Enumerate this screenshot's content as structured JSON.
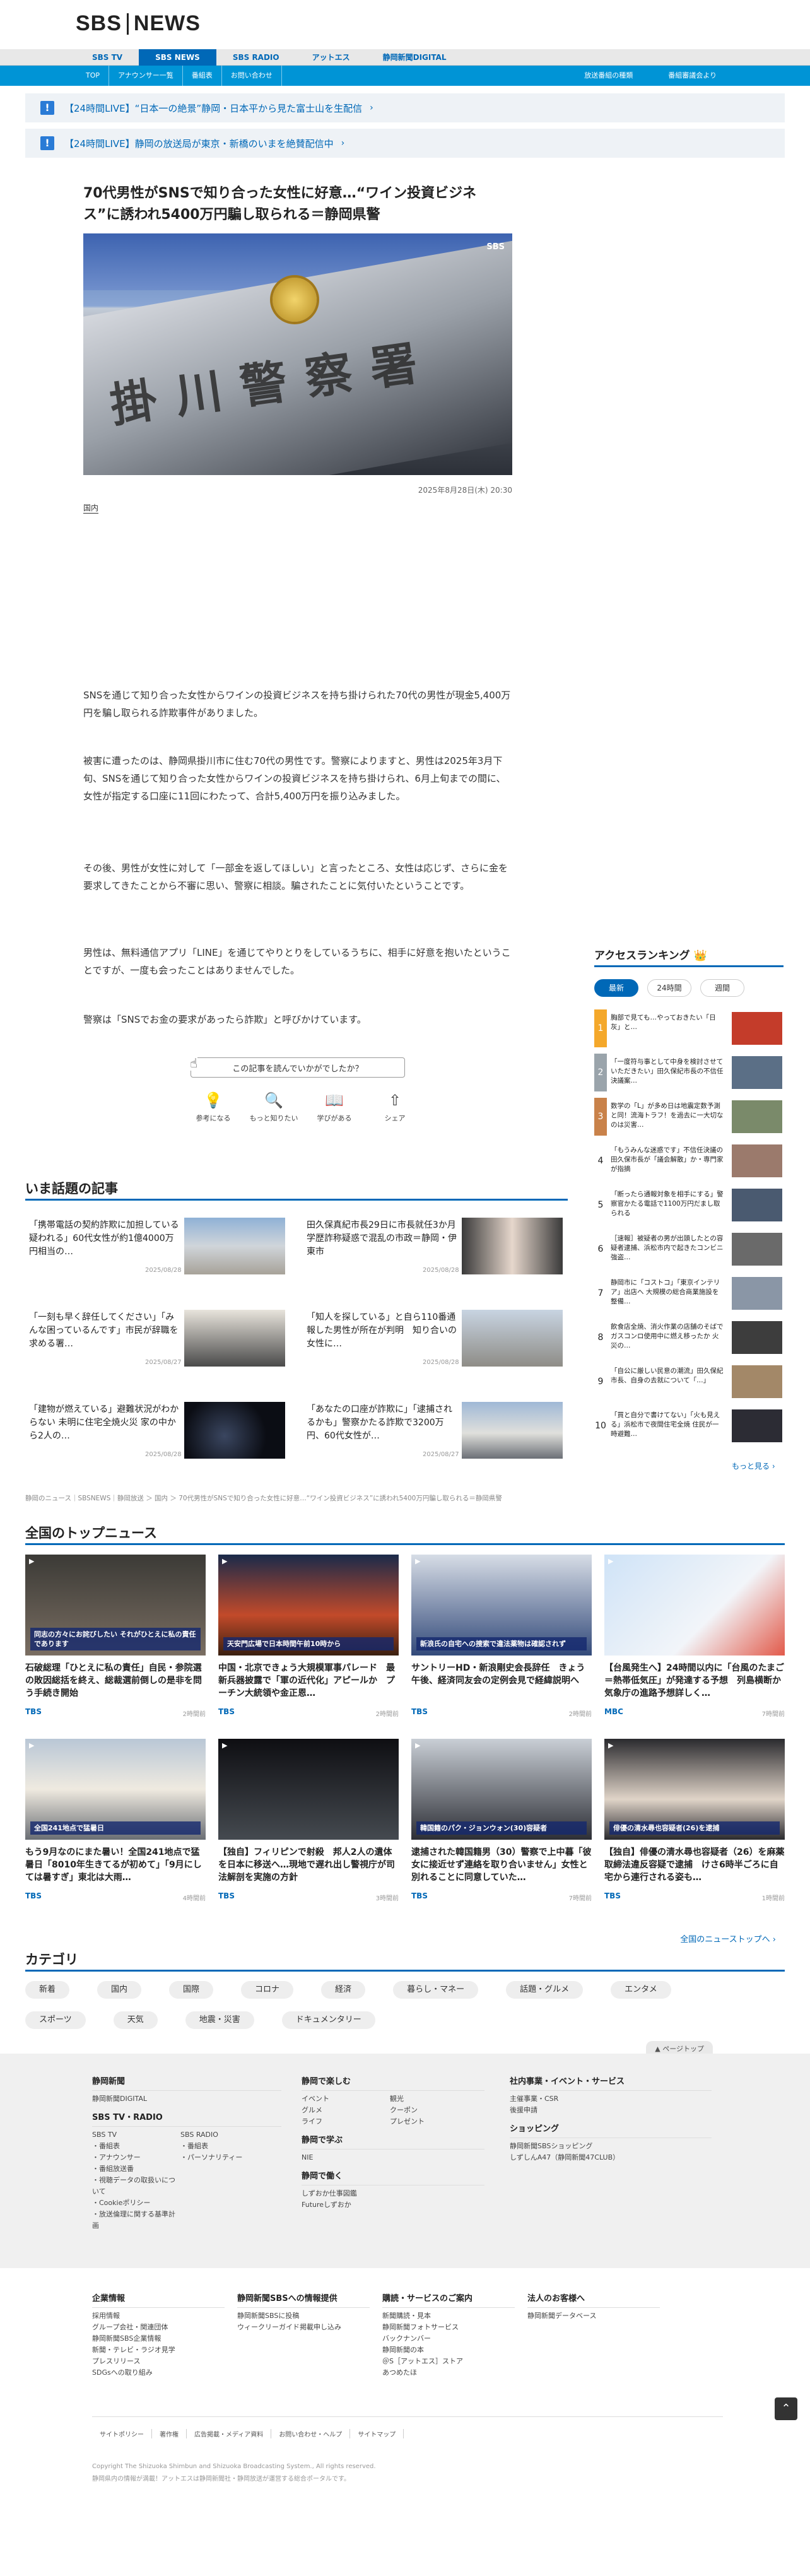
{
  "header": {
    "logo_a": "SBS",
    "logo_b": "NEWS"
  },
  "nav1": [
    {
      "label": "SBS TV"
    },
    {
      "label": "SBS NEWS"
    },
    {
      "label": "SBS RADIO"
    },
    {
      "label": "アットエス"
    },
    {
      "label": "静岡新聞DIGITAL"
    }
  ],
  "nav2": {
    "left": [
      "TOP",
      "アナウンサー一覧",
      "番組表",
      "お問い合わせ"
    ],
    "right": [
      "放送番組の種類",
      "番組審議会より"
    ]
  },
  "alerts": [
    "【24時間LIVE】“日本一の絶景”静岡・日本平から見た富士山を生配信",
    "【24時間LIVE】静岡の放送局が東京・新橋のいまを絶賛配信中"
  ],
  "article": {
    "title": "70代男性がSNSで知り合った女性に好意…“ワイン投資ビジネス”に誘われ5400万円騙し取られる＝静岡県警",
    "image_watermark": "SBS",
    "image_kanji": "掛川警察署",
    "date": "2025年8月28日(木) 20:30",
    "category": "国内",
    "paras": [
      "SNSを通じて知り合った女性からワインの投資ビジネスを持ち掛けられた70代の男性が現金5,400万円を騙し取られる詐欺事件がありました。",
      "被害に遭ったのは、静岡県掛川市に住む70代の男性です。警察によりますと、男性は2025年3月下旬、SNSを通じて知り合った女性からワインの投資ビジネスを持ち掛けられ、6月上旬までの間に、女性が指定する口座に11回にわたって、合計5,400万円を振り込みました。",
      "その後、男性が女性に対して「一部金を返してほしい」と言ったところ、女性は応じず、さらに金を要求してきたことから不審に思い、警察に相談。騙されたことに気付いたということです。",
      "男性は、無料通信アプリ「LINE」を通じてやりとりをしているうちに、相手に好意を抱いたということですが、一度も会ったことはありませんでした。",
      "警察は「SNSでお金の要求があったら詐欺」と呼びかけています。"
    ],
    "question": "この記事を読んでいかがでしたか？",
    "reactions": [
      "参考になる",
      "もっと知りたい",
      "学びがある",
      "シェア"
    ]
  },
  "hot": {
    "heading": "いま話題の記事",
    "items": [
      {
        "text": "「携帯電話の契約詐欺に加担している疑われる」60代女性が約1億4000万円相当の…",
        "date": "2025/08/28"
      },
      {
        "text": "田久保真紀市長29日に市長就任3か月 学歴詐称疑惑で混乱の市政＝静岡・伊東市",
        "date": "2025/08/28"
      },
      {
        "text": "「一刻も早く辞任してください」「みんな困っているんです」市民が辞職を求める署…",
        "date": "2025/08/27"
      },
      {
        "text": "「知人を探している」と自ら110番通報した男性が所在が判明　知り合いの女性に…",
        "date": "2025/08/28"
      },
      {
        "text": "「建物が燃えている」避難状況がわからない 未明に住宅全焼火災 家の中から2人の…",
        "date": "2025/08/28"
      },
      {
        "text": "「あなたの口座が詐欺に」「逮捕されるかも」警察かたる詐欺で3200万円、60代女性が…",
        "date": "2025/08/27"
      }
    ]
  },
  "ranking": {
    "heading": "アクセスランキング",
    "tabs": [
      "最新",
      "24時間",
      "週間"
    ],
    "items": [
      {
        "n": "1",
        "text": "胸部で見ても…やっておきたい「日灰」と…"
      },
      {
        "n": "2",
        "text": "「一度符与事として中身を検討させていただきたい」田久保紀市長の不信任決議案…"
      },
      {
        "n": "3",
        "text": "数学の「L」が多め日は地震定数予測と同！流海トラフ！を過去に一大切なのは災害…"
      },
      {
        "n": "4",
        "text": "「もうみんな迷惑です」不信任決議の田久保市長が「議会解散」か・専門家が指摘"
      },
      {
        "n": "5",
        "text": "「断ったら通報対象を相手にする」警察官かたる電話で1100万円だまし取られる"
      },
      {
        "n": "6",
        "text": "［速報］被疑者の男が出頭したとの容疑者逮捕、浜松市内で起きたコンビニ強盗…"
      },
      {
        "n": "7",
        "text": "静岡市に「コストコ」「東京インテリア」出店へ 大規模の総合商業施設を整備…"
      },
      {
        "n": "8",
        "text": "飲食店全焼、消火作業の店舗のそばでガスコンロ使用中に燃え移ったか 火災の…"
      },
      {
        "n": "9",
        "text": "「自公に厳しい民意の潮流」田久保紀市長、自身の去就について「…」"
      },
      {
        "n": "10",
        "text": "「買と自分で書けてない」「火も見える」浜松市で夜間住宅全焼 住民が一時避難…"
      }
    ],
    "more": "もっと見る"
  },
  "breadcrumb": "静岡のニュース｜SBSNEWS｜静岡放送 ＞ 国内 ＞ 70代男性がSNSで知り合った女性に好意…“ワイン投資ビジネス”に誘われ5400万円騙し取られる＝静岡県警",
  "topnews": {
    "heading": "全国のトップニュース",
    "items": [
      {
        "text": "石破総理「ひとえに私の責任」自民・参院選の敗因総括を終え、総裁選前倒しの是非を問う手続き開始",
        "src": "TBS",
        "date": "2時間前",
        "cap": "同志の方々にお詫びしたい それがひとえに私の責任であります"
      },
      {
        "text": "中国・北京できょう大規模軍事パレード　最新兵器披露で「軍の近代化」アピールか　プーチン大統領や金正恩…",
        "src": "TBS",
        "date": "2時間前",
        "cap": "天安門広場で日本時間午前10時から"
      },
      {
        "text": "サントリーHD・新浪剛史会長辞任　きょう午後、経済同友会の定例会見で経緯説明へ",
        "src": "TBS",
        "date": "2時間前",
        "cap": "新浪氏の自宅への捜索で違法薬物は確認されず"
      },
      {
        "text": "【台風発生へ】24時間以内に「台風のたまご＝熱帯低気圧」が発達する予想　列島横断か　気象庁の進路予想詳しく…",
        "src": "MBC",
        "date": "7時間前",
        "cap": ""
      },
      {
        "text": "もう9月なのにまた暑い！全国241地点で猛暑日「8010年生きてるが初めて」「9月にしては暑すぎ」東北は大雨…",
        "src": "TBS",
        "date": "4時間前",
        "cap": "全国241地点で猛暑日"
      },
      {
        "text": "【独自】フィリピンで射殺　邦人2人の遺体を日本に移送へ…現地で遅れ出し警視庁が司法解剖を実施の方針",
        "src": "TBS",
        "date": "3時間前",
        "cap": ""
      },
      {
        "text": "逮捕された韓国籍男（30）警察で上中暮「彼女に接近せず連絡を取り合いません」女性と別れることに同意していた…",
        "src": "TBS",
        "date": "7時間前",
        "cap": "韓国籍のパク・ジョンウォン(30)容疑者"
      },
      {
        "text": "【独自】俳優の清水尋也容疑者（26）を麻薬取締法違反容疑で逮捕　けさ6時半ごろに自宅から連行される姿も…",
        "src": "TBS",
        "date": "1時間前",
        "cap": "俳優の清水尋也容疑者(26)を逮捕"
      }
    ],
    "all": "全国のニューストップへ"
  },
  "categories": {
    "heading": "カテゴリ",
    "items": [
      "新着",
      "国内",
      "国際",
      "コロナ",
      "経済",
      "暮らし・マネー",
      "話題・グルメ",
      "エンタメ",
      "スポーツ",
      "天気",
      "地震・災害",
      "ドキュメンタリー"
    ]
  },
  "footer": {
    "pagetop": "ページトップ",
    "col1": {
      "h": "静岡新聞",
      "items": [
        "静岡新聞DIGITAL"
      ],
      "h2": "SBS TV・RADIO",
      "a": [
        "SBS TV",
        "・番組表",
        "・アナウンサー",
        "・番組放送番",
        "・視聴データの取扱いについて",
        "・Cookieポリシー",
        "・放送倫理に関する基準計画"
      ],
      "b": [
        "SBS RADIO",
        "・番組表",
        "・パーソナリティー"
      ]
    },
    "col2": {
      "h": "静岡で楽しむ",
      "a": [
        "イベント",
        "グルメ",
        "ライフ"
      ],
      "b": [
        "観光",
        "クーポン",
        "プレゼント"
      ],
      "h2": "静岡で学ぶ",
      "c": [
        "NIE"
      ],
      "h3": "静岡で働く",
      "d": [
        "しずおか仕事図鑑",
        "Futureしずおか"
      ]
    },
    "col3": {
      "h": "社内事業・イベント・サービス",
      "items": [
        "主催事業・CSR",
        "後援申請"
      ],
      "h2": "ショッピング",
      "b": [
        "静岡新聞SBSショッピング",
        "しずしんA47（静岡新聞47CLUB）"
      ]
    },
    "lower": [
      {
        "h": "企業情報",
        "items": [
          "採用情報",
          "グループ会社・関連団体",
          "静岡新聞SBS企業情報",
          "新聞・テレビ・ラジオ見学",
          "プレスリリース",
          "SDGsへの取り組み"
        ]
      },
      {
        "h": "静岡新聞SBSへの情報提供",
        "items": [
          "静岡新聞SBSに投稿",
          "ウィークリーガイド掲載申し込み"
        ]
      },
      {
        "h": "購読・サービスのご案内",
        "items": [
          "新聞購読・見本",
          "静岡新聞フォトサービス",
          "バックナンバー",
          "静岡新聞の本",
          "＠S［アットエス］ストア",
          "あつめたほ"
        ]
      },
      {
        "h": "法人のお客様へ",
        "items": [
          "静岡新聞データベース"
        ]
      }
    ],
    "links": [
      "サイトポリシー",
      "著作権",
      "広告掲載・メディア資料",
      "お問い合わせ・ヘルプ",
      "サイトマップ"
    ],
    "copy1": "Copyright The Shizuoka Shimbun and Shizuoka Broadcasting System., All rights reserved.",
    "copy2": "静岡県内の情報が満載！アットエスは静岡新聞社・静岡放送が運営する総合ポータルです。"
  },
  "colors": {
    "brand": "#0068b7",
    "accent": "#0094d6"
  }
}
